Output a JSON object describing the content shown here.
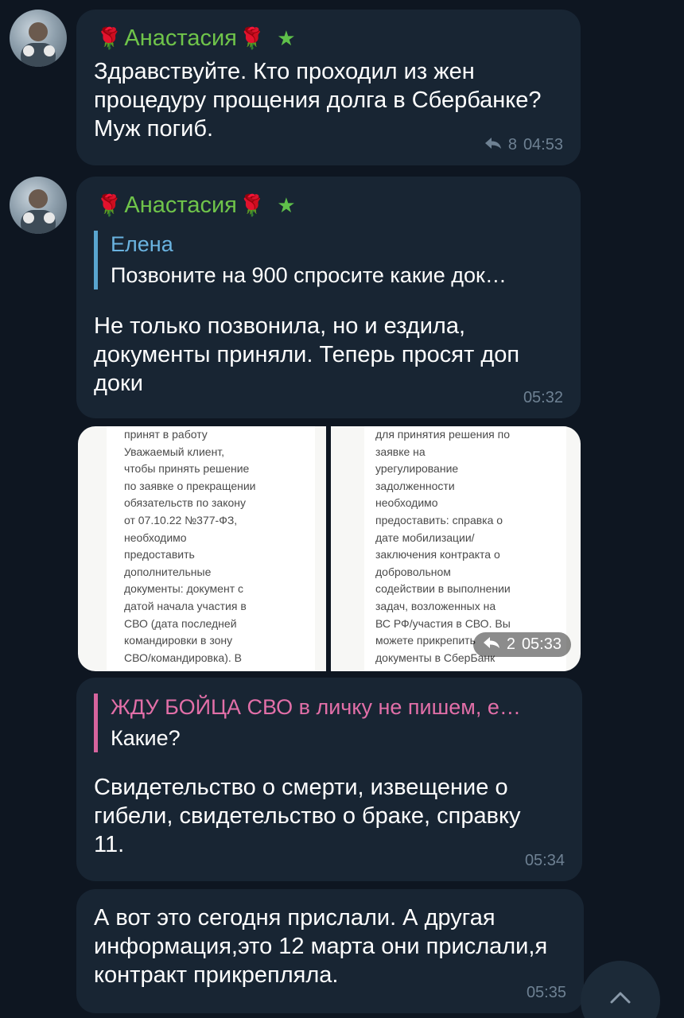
{
  "messages": [
    {
      "sender": "Анастасия",
      "lines": [
        "Здравствуйте. Кто проходил из жен",
        "процедуру прощения долга в Сбербанке?",
        "Муж погиб."
      ],
      "replies_count": "8",
      "time": "04:53"
    },
    {
      "sender": "Анастасия",
      "reply_to": {
        "name": "Елена",
        "text": "Позвоните на 900 спросите какие док…"
      },
      "lines": [
        "Не только позвонила, но и ездила,",
        "документы приняли. Теперь просят доп",
        "доки"
      ],
      "time": "05:32"
    },
    {
      "photo_left_lines": [
        "принят в работу",
        "Уважаемый клиент,",
        "чтобы принять решение",
        "по заявке о прекращении",
        "обязательств по закону",
        "от 07.10.22 №377-ФЗ,",
        "необходимо",
        "предоставить",
        "дополнительные",
        "документы: документ с",
        "датой начала участия в",
        "СВО (дата последней",
        "командировки в зону",
        "СВО/командировка). В"
      ],
      "photo_right_lines": [
        "для принятия решения по",
        "заявке на",
        "урегулирование",
        "задолженности",
        "необходимо",
        "предоставить: справка о",
        "дате мобилизации/",
        "заключения контракта о",
        "добровольном",
        "содействии в выполнении",
        "задач, возложенных на",
        "ВС РФ/участия в СВО. Вы",
        "можете прикрепить",
        "документы в СберБанк"
      ],
      "replies_count": "2",
      "time": "05:33"
    },
    {
      "reply_to": {
        "name": "ЖДУ БОЙЦА СВО в личку не пишем, е…",
        "text": "Какие?"
      },
      "lines": [
        "Свидетельство о смерти, извещение о",
        "гибели, свидетельство о браке, справку",
        "11."
      ],
      "time": "05:34"
    },
    {
      "lines": [
        "А вот это сегодня прислали. А другая",
        "информация,это 12 марта они прислали,я",
        "контракт прикрепляла."
      ],
      "time": "05:35"
    }
  ],
  "colors": {
    "background": "#0e1621",
    "bubble": "#182533",
    "sender_name": "#6fc44a",
    "reply_bar_blue": "#59a5cf",
    "reply_bar_pink": "#d6649e",
    "meta_text": "#6e8193"
  },
  "icons": {
    "sender_decoration": "rose-icon",
    "sender_badge": "star-icon",
    "reply_arrow": "reply-arrow-icon",
    "scroll_down": "chevron-up-icon"
  }
}
